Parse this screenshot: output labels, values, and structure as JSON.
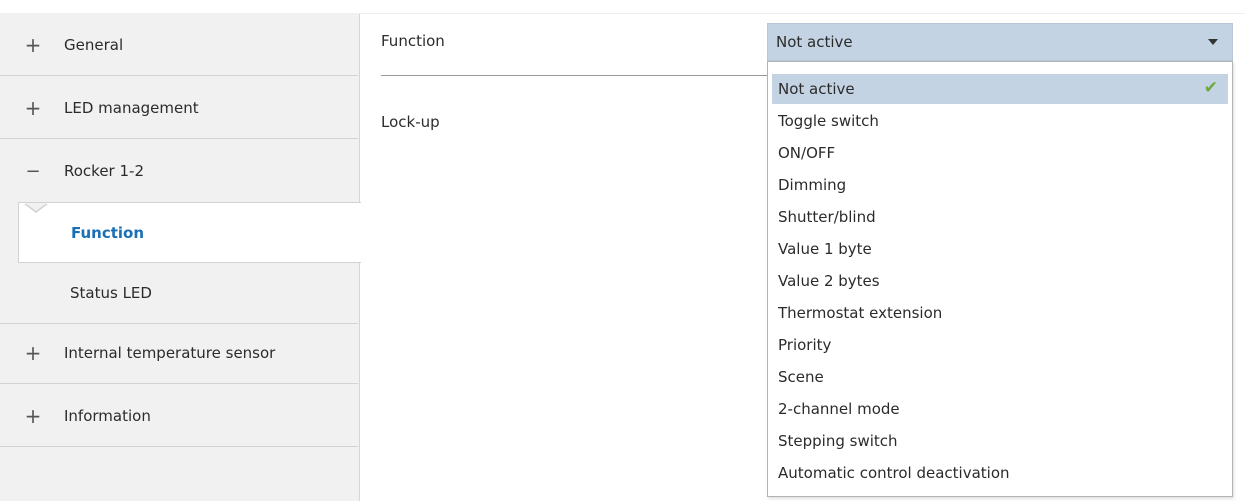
{
  "sidebar": {
    "items": [
      {
        "sign": "+",
        "label": "General"
      },
      {
        "sign": "+",
        "label": "LED management"
      },
      {
        "sign": "−",
        "label": "Rocker 1-2"
      },
      {
        "sign": "+",
        "label": "Internal temperature sensor"
      },
      {
        "sign": "+",
        "label": "Information"
      }
    ],
    "sub_items": [
      {
        "label": "Function",
        "active": true
      },
      {
        "label": "Status LED",
        "active": false
      }
    ]
  },
  "main": {
    "function_label": "Function",
    "lockup_label": "Lock-up",
    "function_select": {
      "value": "Not active",
      "options": [
        "Not active",
        "Toggle switch",
        "ON/OFF",
        "Dimming",
        "Shutter/blind",
        "Value 1 byte",
        "Value 2 bytes",
        "Thermostat extension",
        "Priority",
        "Scene",
        "2-channel mode",
        "Stepping switch",
        "Automatic control deactivation"
      ],
      "check_icon": "✔"
    }
  },
  "colors": {
    "accent": "#1a6fb5",
    "select_bg": "#c4d3e3",
    "check": "#6cab3b"
  }
}
